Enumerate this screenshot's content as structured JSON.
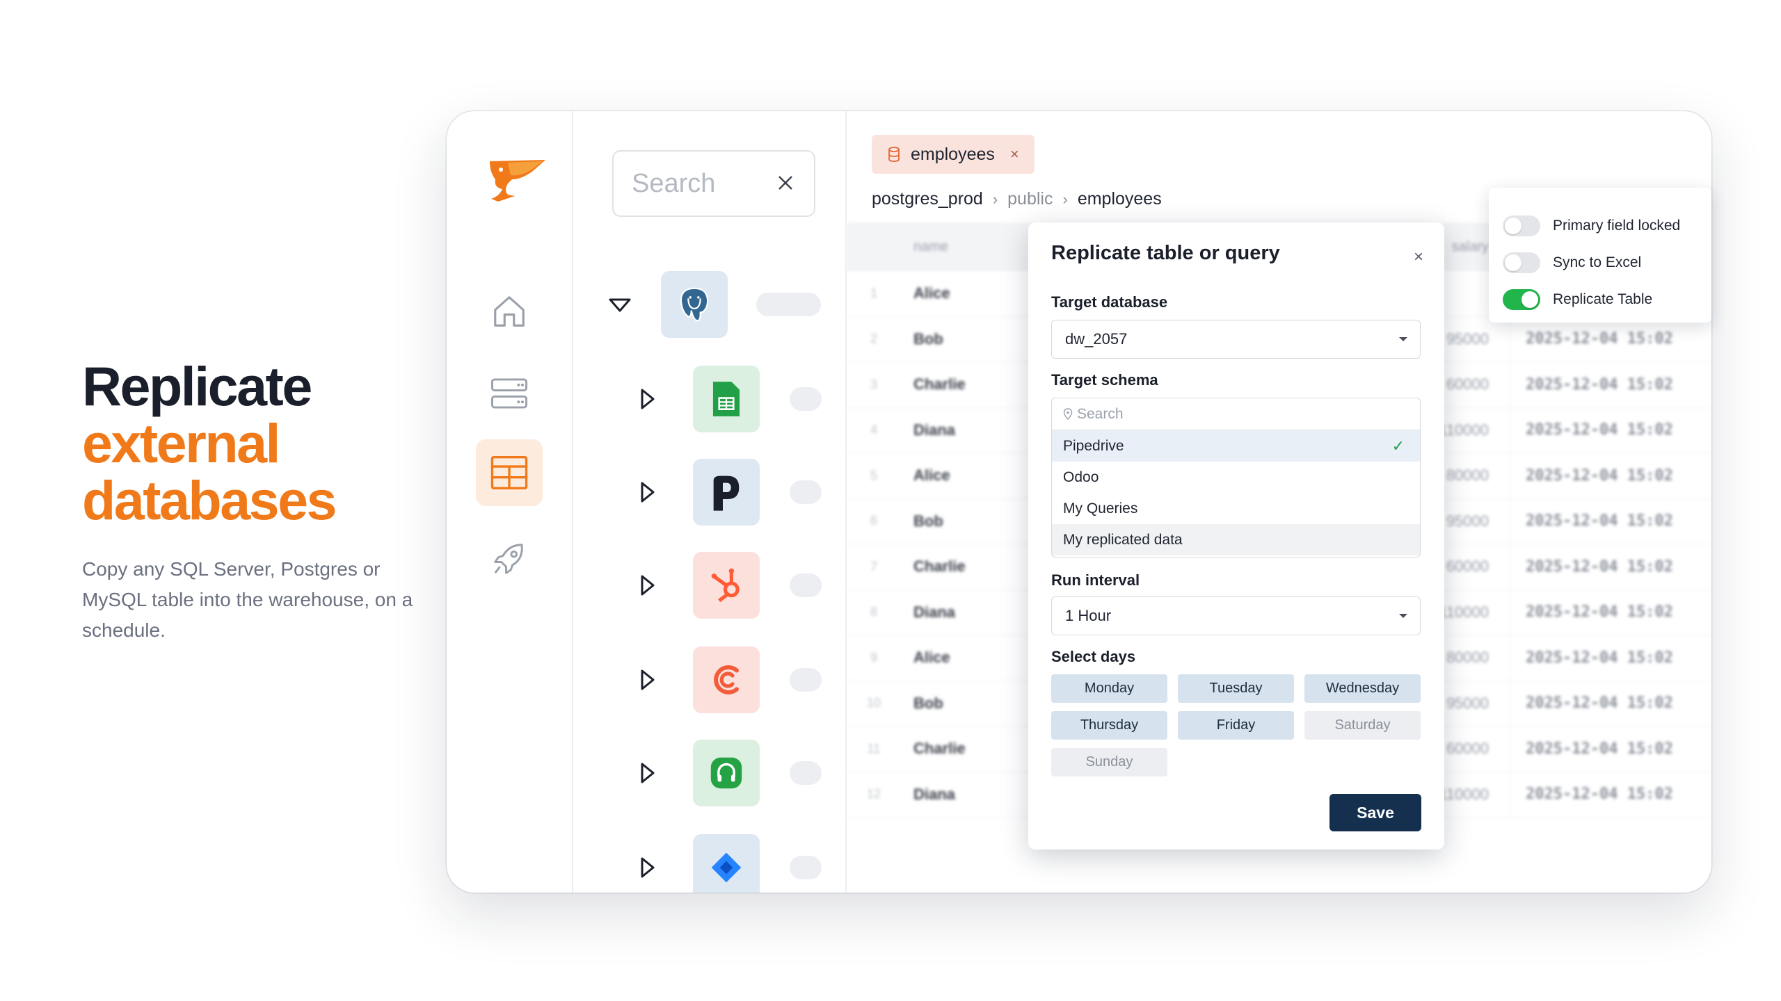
{
  "hero": {
    "line1": "Replicate",
    "line2": "external",
    "line3": "databases",
    "subtitle": "Copy any SQL Server, Postgres or MySQL table into the warehouse, on a schedule."
  },
  "colors": {
    "accent": "#f07a1a",
    "primary": "#15304f",
    "toggle_on": "#22b54b"
  },
  "rail": {
    "items": [
      "home-icon",
      "server-icon",
      "table-icon",
      "rocket-icon"
    ],
    "active": "table-icon"
  },
  "tree": {
    "search_placeholder": "Search",
    "sources": [
      "postgres-icon",
      "google-sheets-icon",
      "pipedrive-icon",
      "hubspot-icon",
      "customer-io-icon",
      "freshdesk-icon",
      "jira-icon"
    ]
  },
  "tab": {
    "label": "employees",
    "close": "×"
  },
  "breadcrumb": {
    "db": "postgres_prod",
    "schema": "public",
    "table": "employees",
    "sep": "›"
  },
  "grid": {
    "columns": [
      "name",
      "salary"
    ],
    "rows": [
      {
        "n": "1",
        "name": "Alice",
        "salary": "",
        "ts": ""
      },
      {
        "n": "2",
        "name": "Bob",
        "salary": "95000",
        "ts": "2025-12-04 15:02"
      },
      {
        "n": "3",
        "name": "Charlie",
        "salary": "60000",
        "ts": "2025-12-04 15:02"
      },
      {
        "n": "4",
        "name": "Diana",
        "salary": "110000",
        "ts": "2025-12-04 15:02"
      },
      {
        "n": "5",
        "name": "Alice",
        "salary": "80000",
        "ts": "2025-12-04 15:02"
      },
      {
        "n": "6",
        "name": "Bob",
        "salary": "95000",
        "ts": "2025-12-04 15:02"
      },
      {
        "n": "7",
        "name": "Charlie",
        "salary": "60000",
        "ts": "2025-12-04 15:02"
      },
      {
        "n": "8",
        "name": "Diana",
        "salary": "110000",
        "ts": "2025-12-04 15:02"
      },
      {
        "n": "9",
        "name": "Alice",
        "salary": "80000",
        "ts": "2025-12-04 15:02"
      },
      {
        "n": "10",
        "name": "Bob",
        "salary": "95000",
        "ts": "2025-12-04 15:02"
      },
      {
        "n": "11",
        "name": "Charlie",
        "salary": "60000",
        "ts": "2025-12-04 15:02"
      },
      {
        "n": "12",
        "name": "Diana",
        "salary": "110000",
        "ts": "2025-12-04 15:02"
      }
    ]
  },
  "toggles": [
    {
      "label": "Primary field locked",
      "on": false
    },
    {
      "label": "Sync to Excel",
      "on": false
    },
    {
      "label": "Replicate Table",
      "on": true
    }
  ],
  "modal": {
    "title": "Replicate table or query",
    "close": "×",
    "target_db_label": "Target database",
    "target_db_value": "dw_2057",
    "target_schema_label": "Target schema",
    "schema_search_placeholder": "Search",
    "schemas": [
      "Pipedrive",
      "Odoo",
      "My Queries",
      "My replicated data"
    ],
    "selected_schema": "Pipedrive",
    "check": "✓",
    "run_interval_label": "Run interval",
    "run_interval_value": "1 Hour",
    "days_label": "Select days",
    "days": [
      {
        "label": "Monday",
        "on": true
      },
      {
        "label": "Tuesday",
        "on": true
      },
      {
        "label": "Wednesday",
        "on": true
      },
      {
        "label": "Thursday",
        "on": true
      },
      {
        "label": "Friday",
        "on": true
      },
      {
        "label": "Saturday",
        "on": false
      },
      {
        "label": "Sunday",
        "on": false
      }
    ],
    "save_label": "Save"
  }
}
